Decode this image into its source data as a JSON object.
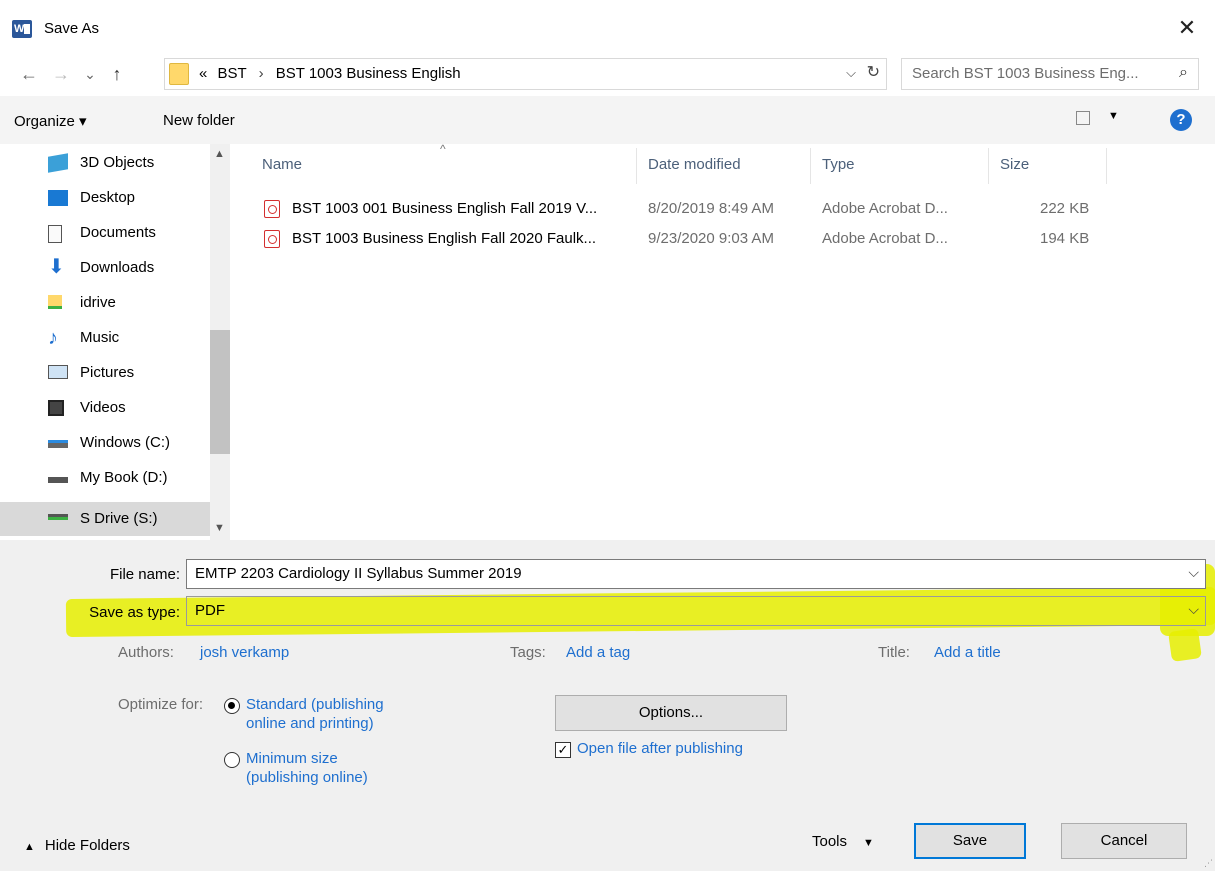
{
  "window": {
    "title": "Save As",
    "app_icon": "word-icon",
    "close_glyph": "✕"
  },
  "nav": {
    "back_glyph": "←",
    "forward_glyph": "→",
    "recent_glyph": "⌄",
    "up_glyph": "↑",
    "breadcrumb_overflow": "«",
    "breadcrumb": [
      "BST",
      "BST 1003 Business English"
    ],
    "breadcrumb_sep": "›",
    "search_placeholder": "Search BST 1003 Business Eng..."
  },
  "command_bar": {
    "organize_label": "Organize ▾",
    "new_folder_label": "New folder",
    "help_glyph": "?"
  },
  "sidebar": {
    "items": [
      {
        "label": "3D Objects",
        "icon": "3d-objects-icon"
      },
      {
        "label": "Desktop",
        "icon": "desktop-icon"
      },
      {
        "label": "Documents",
        "icon": "documents-icon"
      },
      {
        "label": "Downloads",
        "icon": "downloads-icon"
      },
      {
        "label": "idrive",
        "icon": "network-drive-icon"
      },
      {
        "label": "Music",
        "icon": "music-icon"
      },
      {
        "label": "Pictures",
        "icon": "pictures-icon"
      },
      {
        "label": "Videos",
        "icon": "videos-icon"
      },
      {
        "label": "Windows (C:)",
        "icon": "windows-drive-icon"
      },
      {
        "label": "My Book (D:)",
        "icon": "drive-icon"
      },
      {
        "label": "S Drive (S:)",
        "icon": "network-drive-icon",
        "selected": true
      }
    ]
  },
  "file_list": {
    "columns": [
      "Name",
      "Date modified",
      "Type",
      "Size"
    ],
    "rows": [
      {
        "name": "BST 1003 001 Business English Fall 2019 V...",
        "date": "8/20/2019 8:49 AM",
        "type": "Adobe Acrobat D...",
        "size": "222 KB"
      },
      {
        "name": "BST 1003 Business English Fall 2020 Faulk...",
        "date": "9/23/2020 9:03 AM",
        "type": "Adobe Acrobat D...",
        "size": "194 KB"
      }
    ]
  },
  "form": {
    "file_name_label": "File name:",
    "file_name_value": "EMTP 2203 Cardiology II Syllabus Summer 2019",
    "save_type_label": "Save as type:",
    "save_type_value": "PDF",
    "authors_label": "Authors:",
    "authors_value": "josh verkamp",
    "tags_label": "Tags:",
    "tags_value": "Add a tag",
    "title_label": "Title:",
    "title_value": "Add a title",
    "highlight_color": "#e6ef00"
  },
  "options": {
    "optimize_label": "Optimize for:",
    "standard_line1": "Standard (publishing",
    "standard_line2": "online and printing)",
    "minimum_line1": "Minimum size",
    "minimum_line2": "(publishing online)",
    "options_button": "Options...",
    "open_after_label": "Open file after publishing",
    "open_after_checked": true,
    "selected_optimization": "standard"
  },
  "footer": {
    "hide_folders_label": "Hide Folders",
    "tools_label": "Tools",
    "save_label": "Save",
    "cancel_label": "Cancel"
  }
}
